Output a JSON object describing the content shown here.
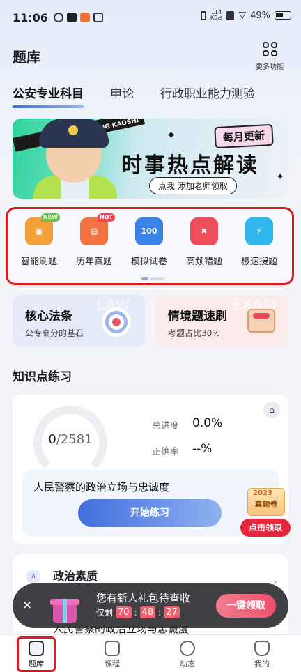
{
  "status_bar": {
    "time": "11:06",
    "speed": "114",
    "speed_unit": "KB/s",
    "battery": "49%"
  },
  "header": {
    "title": "题库",
    "more_label": "更多功能"
  },
  "tabs": [
    {
      "label": "公安专业科目",
      "active": true
    },
    {
      "label": "申论"
    },
    {
      "label": "行政职业能力测验"
    }
  ],
  "banner": {
    "monthly": "每月更新",
    "title": "时事热点解读",
    "subtitle": "点我 添加老师领取",
    "stripe_text": "ZHAOJING KAOSHI"
  },
  "features": [
    {
      "label": "智能刷题",
      "badge": "NEW",
      "icon": "smart-practice-icon",
      "color": "#f3a13b"
    },
    {
      "label": "历年真题",
      "badge": "HOT",
      "icon": "past-exams-icon",
      "color": "#f2733f"
    },
    {
      "label": "模拟试卷",
      "icon_text": "100",
      "icon": "mock-exam-icon",
      "color": "#3b82e6"
    },
    {
      "label": "高频错题",
      "icon": "frequent-mistakes-icon",
      "color": "#ee4d5c"
    },
    {
      "label": "极速搜题",
      "icon": "quick-search-icon",
      "color": "#31b8ee"
    }
  ],
  "cards": [
    {
      "title": "核心法条",
      "subtitle": "公专高分的基石",
      "bg": "#e5eaf8",
      "watermark": "LAW"
    },
    {
      "title": "情境题速刷",
      "subtitle": "考题占比30%",
      "bg": "#fbeaea",
      "watermark": "EXAM"
    }
  ],
  "knowledge": {
    "section_title": "知识点练习",
    "done": "0",
    "total": "/2581",
    "progress_label": "总进度",
    "progress_value": "0.0%",
    "accuracy_label": "正确率",
    "accuracy_value": "--%",
    "topic": "人民警察的政治立场与忠诚度",
    "start_button": "开始练习"
  },
  "promo": {
    "year": "2023",
    "label": "真题卷",
    "button": "点击领取"
  },
  "topic_list": {
    "title": "政治素质",
    "item": "人民警察的政治立场与忠诚度",
    "partial": "0"
  },
  "toast": {
    "message": "您有新人礼包待查收",
    "left_label": "仅剩",
    "hours": "70",
    "minutes": "48",
    "seconds": "27",
    "claim": "一键领取"
  },
  "bottom_nav": [
    {
      "label": "题库",
      "active": true
    },
    {
      "label": "课程"
    },
    {
      "label": "动态"
    },
    {
      "label": "我的"
    }
  ]
}
